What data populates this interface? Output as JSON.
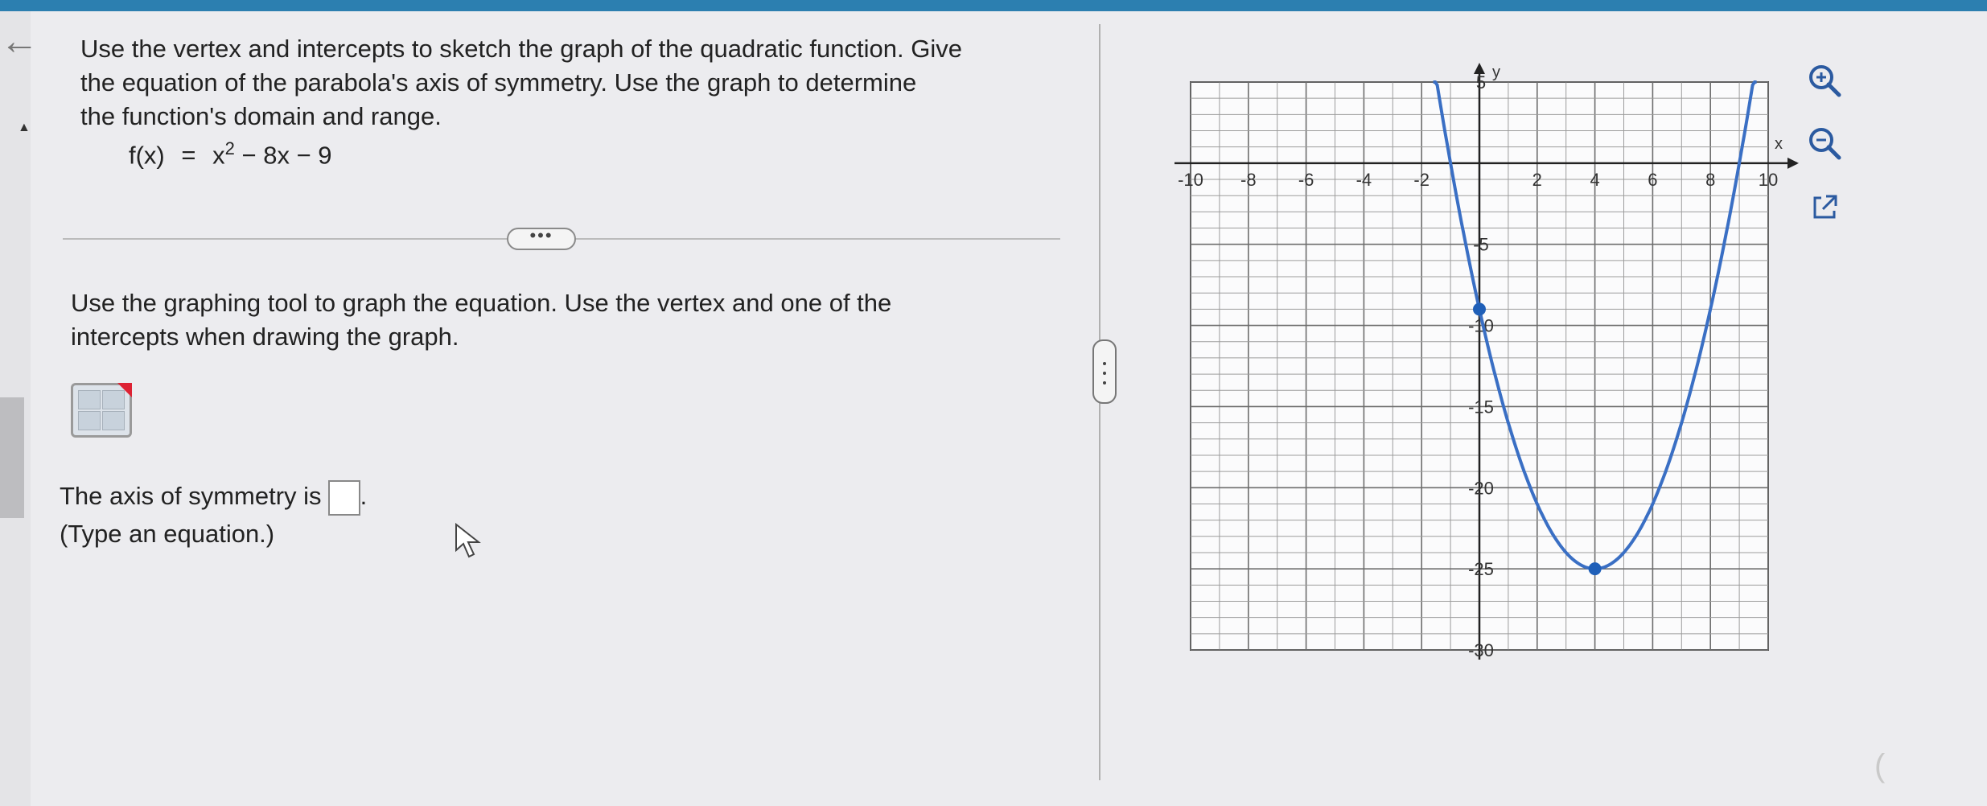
{
  "question": {
    "line1": "Use the vertex and intercepts to sketch the graph of the quadratic function. Give",
    "line2": "the equation of the parabola's axis of symmetry. Use the graph to determine",
    "line3": "the function's domain and range."
  },
  "formula": {
    "lhs": "f(x)",
    "eq": "=",
    "base": "x",
    "exp": "2",
    "rest": "− 8x − 9"
  },
  "more_label": "•••",
  "instruction": {
    "line1": "Use the graphing tool to graph the equation. Use the vertex and one of the",
    "line2": "intercepts when drawing the graph."
  },
  "axis_question": {
    "prefix": "The axis of symmetry is",
    "suffix": ".",
    "hint": "(Type an equation.)"
  },
  "icons": {
    "back": "back-arrow-icon",
    "graph_tool": "graphing-tool-icon",
    "zoom_in": "zoom-in-icon",
    "zoom_out": "zoom-out-icon",
    "popout": "popout-icon",
    "cursor": "mouse-cursor-icon"
  },
  "colors": {
    "curve": "#3a6fc4",
    "point": "#1f5fb8",
    "accent_bar": "#2c7fb0"
  },
  "chart_data": {
    "type": "line",
    "xlabel": "x",
    "ylabel": "y",
    "xlim": [
      -10,
      10
    ],
    "ylim": [
      -30,
      5
    ],
    "grid": true,
    "minor_grid_step": 1,
    "x_ticks": [
      "-10",
      "-8",
      "-6",
      "-4",
      "-2",
      "2",
      "4",
      "6",
      "8",
      "10"
    ],
    "y_ticks": [
      "5",
      "-5",
      "-10",
      "-15",
      "-20",
      "-25",
      "-30"
    ],
    "series": [
      {
        "function": "x^2 - 8x - 9",
        "x_range": [
          -1.6,
          9.6
        ],
        "color": "#3a6fc4"
      }
    ],
    "points": [
      {
        "x": 0,
        "y": -9
      },
      {
        "x": 4,
        "y": -25
      }
    ]
  }
}
